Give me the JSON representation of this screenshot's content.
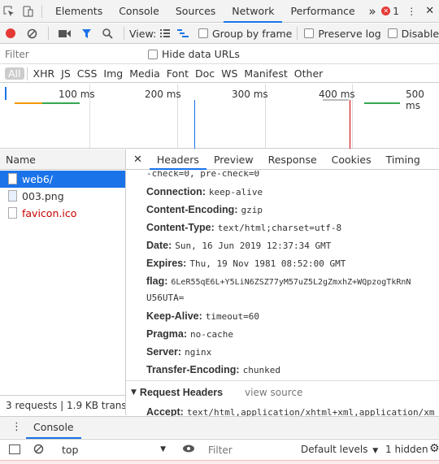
{
  "tabs": [
    "Elements",
    "Console",
    "Sources",
    "Network",
    "Performance"
  ],
  "error_count": "1",
  "toolbar": {
    "view_label": "View:",
    "group_by_frame": "Group by frame",
    "preserve_log": "Preserve log",
    "disable_cache": "Disable"
  },
  "filter": {
    "placeholder": "Filter",
    "hide_data_urls": "Hide data URLs"
  },
  "types": [
    "All",
    "XHR",
    "JS",
    "CSS",
    "Img",
    "Media",
    "Font",
    "Doc",
    "WS",
    "Manifest",
    "Other"
  ],
  "timeline_ticks": [
    "100 ms",
    "200 ms",
    "300 ms",
    "400 ms",
    "500 ms"
  ],
  "name_header": "Name",
  "requests": [
    "web6/",
    "003.png",
    "favicon.ico"
  ],
  "summary": "3 requests | 1.9 KB transf...",
  "detail_tabs": [
    "Headers",
    "Preview",
    "Response",
    "Cookies",
    "Timing"
  ],
  "headers_partial": "-check=0, pre-check=0",
  "headers": [
    {
      "name": "Connection:",
      "value": "keep-alive"
    },
    {
      "name": "Content-Encoding:",
      "value": "gzip"
    },
    {
      "name": "Content-Type:",
      "value": "text/html;charset=utf-8"
    },
    {
      "name": "Date:",
      "value": "Sun, 16 Jun 2019 12:37:34 GMT"
    },
    {
      "name": "Expires:",
      "value": "Thu, 19 Nov 1981 08:52:00 GMT"
    },
    {
      "name": "flag:",
      "value": "6LeR55qE6L+Y5LiN6ZSZ77yM57uZ5L2gZmxhZ+WQpzogTkRnN"
    },
    {
      "name": "Keep-Alive:",
      "value": "timeout=60"
    },
    {
      "name": "Pragma:",
      "value": "no-cache"
    },
    {
      "name": "Server:",
      "value": "nginx"
    },
    {
      "name": "Transfer-Encoding:",
      "value": "chunked"
    }
  ],
  "flag_cont": "U56UTA=",
  "request_headers": {
    "title": "Request Headers",
    "view_source": "view source"
  },
  "accept_line": {
    "name": "Accept:",
    "value": "text/html,application/xhtml+xml,application/xm"
  },
  "console_drawer": {
    "tab": "Console",
    "context": "top",
    "filter_placeholder": "Filter",
    "levels": "Default levels",
    "hidden": "1 hidden"
  }
}
